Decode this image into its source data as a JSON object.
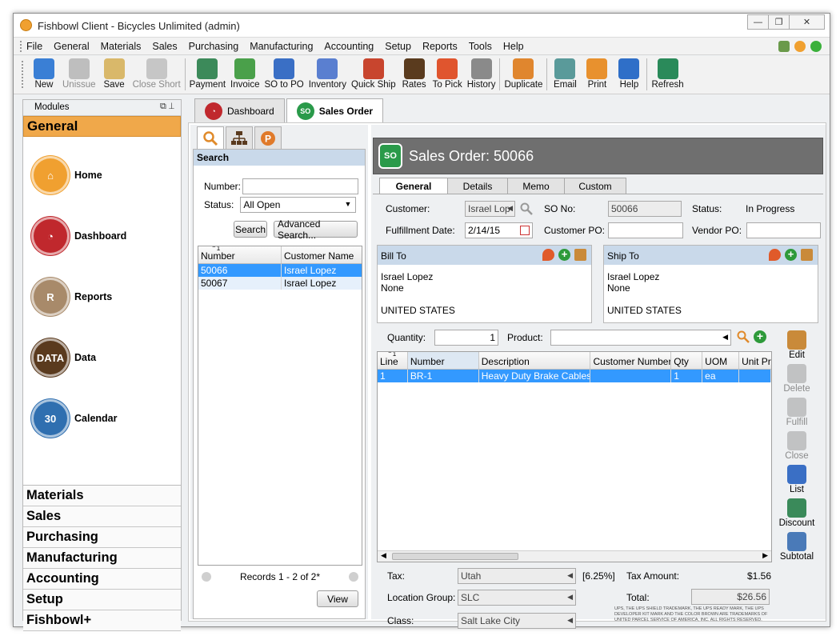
{
  "window": {
    "title": "Fishbowl Client - Bicycles Unlimited (admin)"
  },
  "menu": [
    "File",
    "General",
    "Materials",
    "Sales",
    "Purchasing",
    "Manufacturing",
    "Accounting",
    "Setup",
    "Reports",
    "Tools",
    "Help"
  ],
  "toolbar": [
    {
      "label": "New",
      "icon": "new-icon",
      "color": "#3a7fd5",
      "disabled": false
    },
    {
      "label": "Unissue",
      "icon": "unissue-icon",
      "color": "#8a8a8a",
      "disabled": true
    },
    {
      "label": "Save",
      "icon": "save-icon",
      "color": "#d9b86a",
      "disabled": false
    },
    {
      "label": "Close Short",
      "icon": "close-short-icon",
      "color": "#9a9a9a",
      "disabled": true
    },
    {
      "label": "Payment",
      "icon": "payment-icon",
      "color": "#3c8a5a",
      "disabled": false
    },
    {
      "label": "Invoice",
      "icon": "invoice-icon",
      "color": "#4aa04a",
      "disabled": false
    },
    {
      "label": "SO to PO",
      "icon": "so-to-po-icon",
      "color": "#3a6fc5",
      "disabled": false
    },
    {
      "label": "Inventory",
      "icon": "inventory-icon",
      "color": "#5a7fd0",
      "disabled": false
    },
    {
      "label": "Quick Ship",
      "icon": "quick-ship-icon",
      "color": "#c8452e",
      "disabled": false
    },
    {
      "label": "Rates",
      "icon": "ups-rates-icon",
      "color": "#5a3b1e",
      "disabled": false
    },
    {
      "label": "To Pick",
      "icon": "to-pick-icon",
      "color": "#e0552e",
      "disabled": false
    },
    {
      "label": "History",
      "icon": "history-icon",
      "color": "#8a8a8a",
      "disabled": false
    },
    {
      "label": "Duplicate",
      "icon": "duplicate-icon",
      "color": "#e0862e",
      "disabled": false
    },
    {
      "label": "Email",
      "icon": "email-icon",
      "color": "#5a9a9a",
      "disabled": false
    },
    {
      "label": "Print",
      "icon": "print-icon",
      "color": "#e8912e",
      "disabled": false
    },
    {
      "label": "Help",
      "icon": "help-icon",
      "color": "#2f6fc8",
      "disabled": false
    },
    {
      "label": "Refresh",
      "icon": "refresh-icon",
      "color": "#2a8a5a",
      "disabled": false
    }
  ],
  "modules": {
    "header": "Modules",
    "active": "General",
    "items": [
      {
        "label": "Home",
        "icon": "home-icon",
        "color": "#f0a030",
        "glyph": "⌂"
      },
      {
        "label": "Dashboard",
        "icon": "dashboard-icon",
        "color": "#c0282d",
        "glyph": "◔"
      },
      {
        "label": "Reports",
        "icon": "reports-icon",
        "color": "#a88a6a",
        "glyph": "R"
      },
      {
        "label": "Data",
        "icon": "data-icon",
        "color": "#5a3a1e",
        "glyph": "DATA"
      },
      {
        "label": "Calendar",
        "icon": "calendar-icon",
        "color": "#2f6fb0",
        "glyph": "30"
      }
    ],
    "categories": [
      "Materials",
      "Sales",
      "Purchasing",
      "Manufacturing",
      "Accounting",
      "Setup",
      "Fishbowl+"
    ]
  },
  "tabs": [
    {
      "label": "Dashboard"
    },
    {
      "label": "Sales Order"
    }
  ],
  "search": {
    "header": "Search",
    "number_label": "Number:",
    "number_value": "",
    "status_label": "Status:",
    "status_value": "All Open",
    "search_btn": "Search",
    "advanced_btn": "Advanced Search...",
    "columns": [
      "Number",
      "Customer Name"
    ],
    "sort_indicator": "1",
    "rows": [
      {
        "number": "50066",
        "customer": "Israel Lopez"
      },
      {
        "number": "50067",
        "customer": "Israel Lopez"
      }
    ],
    "records": "Records 1 - 2 of 2*",
    "view_btn": "View"
  },
  "so": {
    "title": "Sales Order: 50066",
    "tabs": [
      "General",
      "Details",
      "Memo",
      "Custom"
    ],
    "customer_label": "Customer:",
    "customer_value": "Israel Lop",
    "so_no_label": "SO No:",
    "so_no_value": "50066",
    "status_label": "Status:",
    "status_value": "In Progress",
    "fulfillment_label": "Fulfillment Date:",
    "fulfillment_value": "2/14/15",
    "customer_po_label": "Customer PO:",
    "vendor_po_label": "Vendor PO:",
    "bill_to": {
      "title": "Bill To",
      "lines": [
        "Israel Lopez",
        "None",
        "",
        "UNITED STATES"
      ]
    },
    "ship_to": {
      "title": "Ship To",
      "lines": [
        "Israel Lopez",
        "None",
        "",
        "UNITED STATES"
      ]
    },
    "quantity_label": "Quantity:",
    "quantity_value": "1",
    "product_label": "Product:",
    "columns": [
      "Line",
      "Number",
      "Description",
      "Customer Number",
      "Qty",
      "UOM",
      "Unit Pric"
    ],
    "sort_indicator": "1",
    "items": [
      {
        "line": "1",
        "number": "BR-1",
        "description": "Heavy Duty Brake Cables",
        "customer_number": "",
        "qty": "1",
        "uom": "ea",
        "unit_price": ""
      }
    ],
    "actions": [
      {
        "label": "Edit",
        "icon": "edit-icon",
        "color": "#c98a3a",
        "disabled": false
      },
      {
        "label": "Delete",
        "icon": "delete-icon",
        "color": "#8a8a8a",
        "disabled": true
      },
      {
        "label": "Fulfill",
        "icon": "fulfill-icon",
        "color": "#8a8a8a",
        "disabled": true
      },
      {
        "label": "Close",
        "icon": "close-item-icon",
        "color": "#8a8a8a",
        "disabled": true
      },
      {
        "label": "List",
        "icon": "list-icon",
        "color": "#3a6fc5",
        "disabled": false
      },
      {
        "label": "Discount",
        "icon": "discount-icon",
        "color": "#3a8a5a",
        "disabled": false
      },
      {
        "label": "Subtotal",
        "icon": "subtotal-icon",
        "color": "#4a7ab8",
        "disabled": false
      }
    ],
    "tax_label": "Tax:",
    "tax_value": "Utah",
    "tax_rate": "[6.25%]",
    "tax_amount_label": "Tax Amount:",
    "tax_amount": "$1.56",
    "location_label": "Location Group:",
    "location_value": "SLC",
    "total_label": "Total:",
    "total_value": "$26.56",
    "class_label": "Class:",
    "class_value": "Salt Lake City",
    "ups_notice": "UPS, THE UPS SHIELD TRADEMARK, THE UPS READY MARK, THE UPS DEVELOPER KIT MARK AND THE COLOR BROWN ARE TRADEMARKS OF UNITED PARCEL SERVICE OF AMERICA, INC. ALL RIGHTS RESERVED."
  }
}
